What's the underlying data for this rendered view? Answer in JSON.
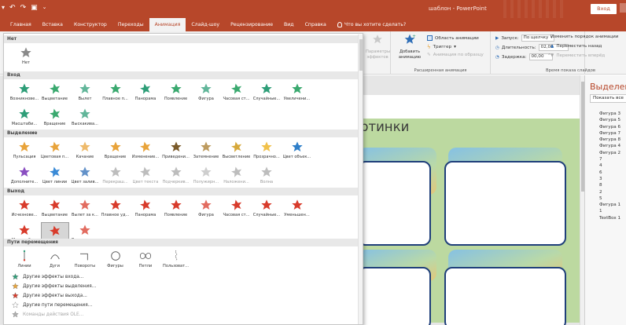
{
  "window": {
    "qat_icons": [
      "undo-icon",
      "redo-icon",
      "present-icon",
      "customize-icon"
    ],
    "title": "шаблон - PowerPoint",
    "sign_in": "Вход"
  },
  "tabs": [
    {
      "label": "Главная"
    },
    {
      "label": "Вставка"
    },
    {
      "label": "Конструктор"
    },
    {
      "label": "Переходы"
    },
    {
      "label": "Анимация",
      "active": true
    },
    {
      "label": "Слайд-шоу"
    },
    {
      "label": "Рецензирование"
    },
    {
      "label": "Вид"
    },
    {
      "label": "Справка"
    }
  ],
  "tell_me": "Что вы хотите сделать?",
  "ribbon": {
    "effect_options": "Параметры эффектов",
    "add_animation": "Добавить анимацию",
    "animation_pane": "Область анимации",
    "trigger": "Триггер",
    "animation_painter": "Анимация по образцу",
    "advanced_group": "Расширенная анимация",
    "start_label": "Запуск:",
    "start_value": "По щелчку",
    "duration_label": "Длительность:",
    "duration_value": "02,00",
    "delay_label": "Задержка:",
    "delay_value": "00,00",
    "timing_group": "Время показа слайдов",
    "reorder_title": "Изменить порядок анимации",
    "move_earlier": "Переместить назад",
    "move_later": "Переместить вперёд"
  },
  "slide": {
    "title_fragment": "ртинки"
  },
  "animation_pane": {
    "title": "Выделение",
    "show_button": "Показать все",
    "items": [
      "Фигура 3",
      "Фигура 5",
      "Фигура 6",
      "Фигура 7",
      "Фигура 8",
      "Фигура 4",
      "Фигура 2",
      "7",
      "4",
      "6",
      "3",
      "8",
      "2",
      "5",
      "Фигура 1",
      "1",
      "TextBox 1"
    ]
  },
  "gallery": {
    "none_header": "Нет",
    "none_item": "Нет",
    "sections": [
      {
        "title": "Вход",
        "color": "#2e9e78",
        "rows": [
          [
            {
              "label": "Возникнове...",
              "icon": "star-appear-icon"
            },
            {
              "label": "Выцветание",
              "icon": "star-fade-icon"
            },
            {
              "label": "Вылет",
              "icon": "star-fly-in-icon"
            },
            {
              "label": "Плавное п...",
              "icon": "star-float-in-icon"
            },
            {
              "label": "Панорама",
              "icon": "star-split-icon"
            },
            {
              "label": "Появление",
              "icon": "star-wipe-icon"
            },
            {
              "label": "Фигура",
              "icon": "star-shape-icon"
            },
            {
              "label": "Часовая ст...",
              "icon": "star-wheel-icon"
            },
            {
              "label": "Случайные...",
              "icon": "star-random-bars-icon"
            },
            {
              "label": "Увеличени...",
              "icon": "star-grow-turn-icon"
            }
          ],
          [
            {
              "label": "Масштаби...",
              "icon": "star-zoom-icon"
            },
            {
              "label": "Вращение",
              "icon": "star-swivel-icon"
            },
            {
              "label": "Выскакива...",
              "icon": "star-bounce-icon"
            }
          ]
        ]
      },
      {
        "title": "Выделение",
        "color": "#e8a33a",
        "rows": [
          [
            {
              "label": "Пульсация",
              "icon": "star-pulse-icon"
            },
            {
              "label": "Цветовая п...",
              "icon": "star-color-pulse-icon"
            },
            {
              "label": "Качание",
              "icon": "star-teeter-icon"
            },
            {
              "label": "Вращение",
              "icon": "star-spin-icon"
            },
            {
              "label": "Изменение...",
              "icon": "star-grow-shrink-icon"
            },
            {
              "label": "Приведени...",
              "icon": "star-desaturate-icon"
            },
            {
              "label": "Затемнение",
              "icon": "star-darken-icon"
            },
            {
              "label": "Высветление",
              "icon": "star-lighten-icon"
            },
            {
              "label": "Прозрачно...",
              "icon": "star-transparency-icon"
            },
            {
              "label": "Цвет объек...",
              "icon": "star-object-color-icon"
            }
          ],
          [
            {
              "label": "Дополните...",
              "icon": "star-complementary-icon"
            },
            {
              "label": "Цвет линии",
              "icon": "star-line-color-icon"
            },
            {
              "label": "Цвет залив...",
              "icon": "star-fill-color-icon"
            },
            {
              "label": "Перекраш...",
              "icon": "star-brush-color-icon",
              "disabled": true
            },
            {
              "label": "Цвет текста",
              "icon": "star-font-color-icon",
              "disabled": true
            },
            {
              "label": "Подчеркив...",
              "icon": "star-underline-icon",
              "disabled": true
            },
            {
              "label": "Полужирн...",
              "icon": "star-bold-flash-icon",
              "disabled": true
            },
            {
              "label": "Наложени...",
              "icon": "star-bold-reveal-icon",
              "disabled": true
            },
            {
              "label": "Волна",
              "icon": "star-wave-icon",
              "disabled": true
            }
          ]
        ]
      },
      {
        "title": "Выход",
        "color": "#d83b2b",
        "rows": [
          [
            {
              "label": "Исчезнове...",
              "icon": "star-disappear-icon"
            },
            {
              "label": "Выцветание",
              "icon": "star-fade-out-icon"
            },
            {
              "label": "Вылет за к...",
              "icon": "star-fly-out-icon"
            },
            {
              "label": "Плавное уд...",
              "icon": "star-float-out-icon"
            },
            {
              "label": "Панорама",
              "icon": "star-split-out-icon"
            },
            {
              "label": "Появление",
              "icon": "star-wipe-out-icon"
            },
            {
              "label": "Фигура",
              "icon": "star-shape-out-icon"
            },
            {
              "label": "Часовая ст...",
              "icon": "star-wheel-out-icon"
            },
            {
              "label": "Случайные...",
              "icon": "star-random-out-icon"
            },
            {
              "label": "Уменьшен...",
              "icon": "star-shrink-turn-icon"
            }
          ],
          [
            {
              "label": "Масштаби...",
              "icon": "star-zoom-out-icon"
            },
            {
              "label": "Вращение",
              "icon": "star-swivel-out-icon",
              "selected": true
            },
            {
              "label": "Выскакива...",
              "icon": "star-bounce-out-icon"
            }
          ]
        ]
      }
    ],
    "paths_title": "Пути перемещения",
    "paths": [
      {
        "label": "Линии",
        "icon": "path-line-icon"
      },
      {
        "label": "Дуги",
        "icon": "path-arc-icon"
      },
      {
        "label": "Повороты",
        "icon": "path-turn-icon"
      },
      {
        "label": "Фигуры",
        "icon": "path-shape-icon"
      },
      {
        "label": "Петли",
        "icon": "path-loop-icon"
      },
      {
        "label": "Пользоват...",
        "icon": "path-custom-icon"
      }
    ],
    "more": [
      {
        "label": "Другие эффекты входа...",
        "icon": "entrance-star-icon",
        "color": "#2e9e78"
      },
      {
        "label": "Другие эффекты выделения...",
        "icon": "emphasis-star-icon",
        "color": "#e8a33a"
      },
      {
        "label": "Другие эффекты выхода...",
        "icon": "exit-star-icon",
        "color": "#d83b2b"
      },
      {
        "label": "Другие пути перемещения...",
        "icon": "motion-path-star-icon",
        "color": "#ffffff"
      },
      {
        "label": "Команды действия OLE...",
        "icon": "ole-action-icon",
        "color": "#b0b0b0",
        "disabled": true
      }
    ]
  }
}
